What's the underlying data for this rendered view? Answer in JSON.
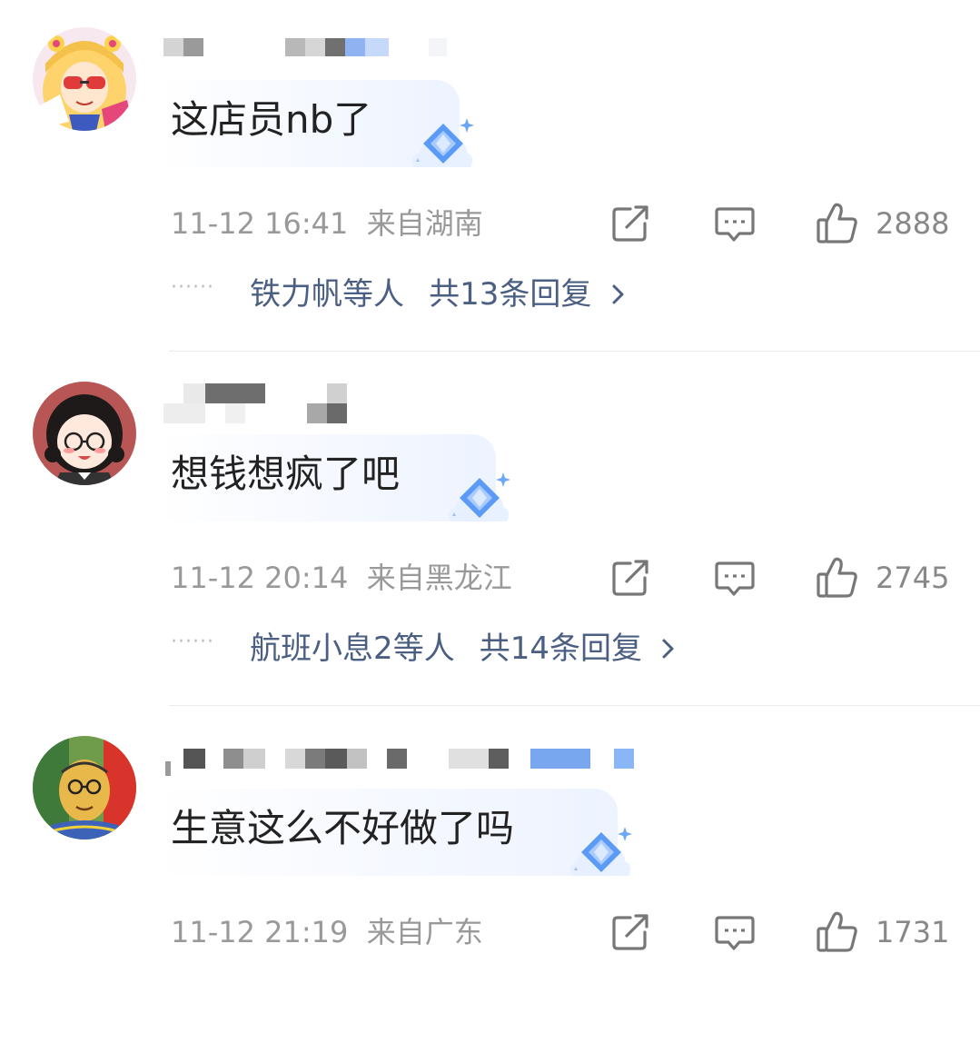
{
  "comments": [
    {
      "text": "这店员nb了",
      "time": "11-12 16:41",
      "location": "来自湖南",
      "likes": "2888",
      "reply_names": "铁力帆等人",
      "reply_total": "共13条回复"
    },
    {
      "text": "想钱想疯了吧",
      "time": "11-12 20:14",
      "location": "来自黑龙江",
      "likes": "2745",
      "reply_names": "航班小息2等人",
      "reply_total": "共14条回复"
    },
    {
      "text": "生意这么不好做了吗",
      "time": "11-12 21:19",
      "location": "来自广东",
      "likes": "1731",
      "reply_names": "",
      "reply_total": ""
    }
  ],
  "reply_dots": "······",
  "icons": {
    "share": "share-icon",
    "reply": "comment-icon",
    "like": "thumbs-up-icon",
    "badge": "diamond-badge-icon",
    "more": "chevron-right-icon"
  },
  "colors": {
    "reply_link": "#4a5f82",
    "meta_text": "#999999",
    "bubble_tint": "#edf3ff",
    "badge_blue": "#5b9af5"
  }
}
